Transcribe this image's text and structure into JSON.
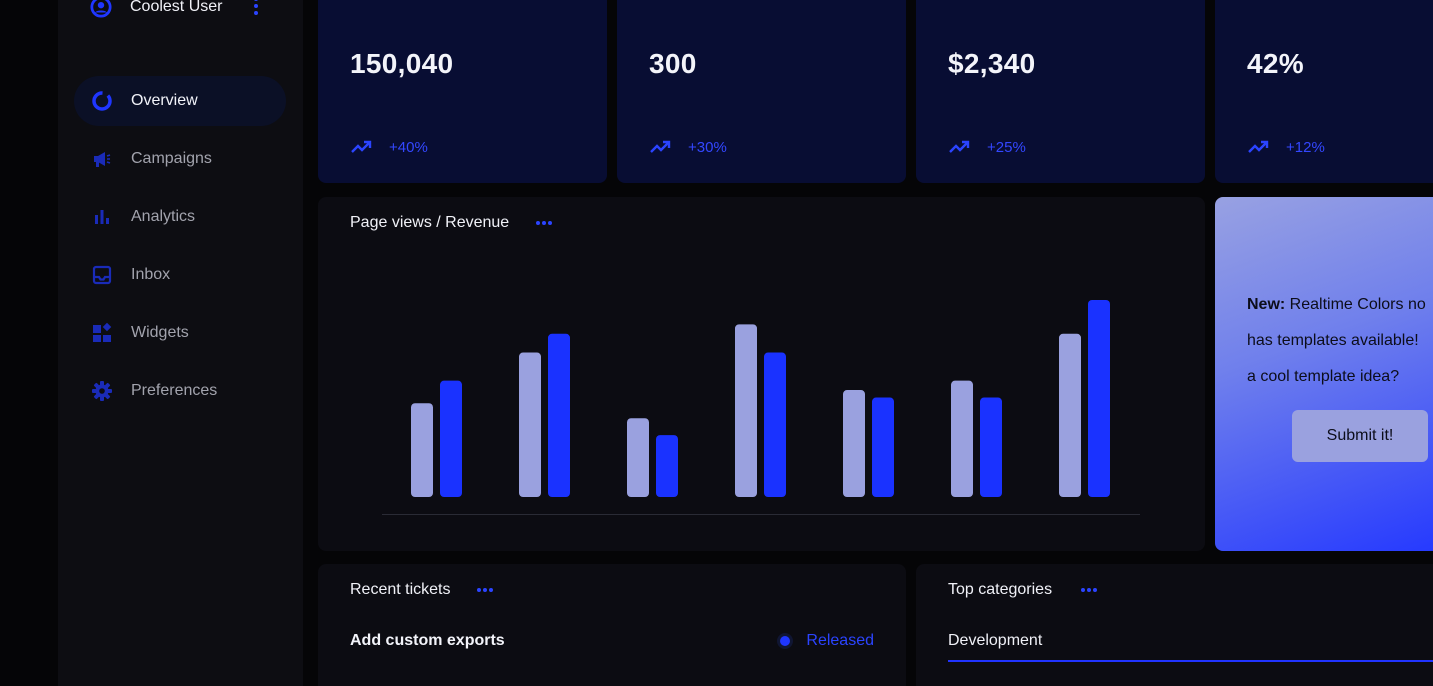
{
  "user": {
    "name": "Coolest User"
  },
  "sidebar": {
    "items": [
      {
        "label": "Overview",
        "icon": "overview-icon",
        "active": true
      },
      {
        "label": "Campaigns",
        "icon": "megaphone-icon"
      },
      {
        "label": "Analytics",
        "icon": "bar-chart-icon"
      },
      {
        "label": "Inbox",
        "icon": "inbox-icon"
      },
      {
        "label": "Widgets",
        "icon": "widgets-icon"
      },
      {
        "label": "Preferences",
        "icon": "gear-icon"
      }
    ]
  },
  "stats": [
    {
      "value": "150,040",
      "change": "+40%"
    },
    {
      "value": "300",
      "change": "+30%"
    },
    {
      "value": "$2,340",
      "change": "+25%"
    },
    {
      "value": "42%",
      "change": "+12%"
    }
  ],
  "chart": {
    "title": "Page views / Revenue"
  },
  "chart_data": {
    "type": "bar",
    "categories": [
      "",
      "",
      "",
      "",
      "",
      "",
      ""
    ],
    "series": [
      {
        "values": [
          50,
          77,
          42,
          92,
          57,
          62,
          87
        ]
      },
      {
        "values": [
          62,
          87,
          33,
          77,
          53,
          53,
          105
        ]
      }
    ],
    "ylim": [
      0,
      105
    ],
    "grid": false,
    "colors": [
      "#9aa1df",
      "#1a32ff"
    ]
  },
  "promo": {
    "bold": "New:",
    "line1": " Realtime Colors no",
    "line2": "has templates available!",
    "line3": "a cool template idea?",
    "button": "Submit it!"
  },
  "tickets": {
    "title": "Recent tickets",
    "rows": [
      {
        "title": "Add custom exports",
        "status": "Released"
      }
    ]
  },
  "categories": {
    "title": "Top categories",
    "tabs": [
      {
        "label": "Development"
      }
    ]
  },
  "colors": {
    "accent": "#1a32ff",
    "accent_light": "#9aa1df",
    "stat_bg": "#080d33",
    "card_bg": "#0c0c12",
    "sidebar_bg": "#0d0d12"
  }
}
